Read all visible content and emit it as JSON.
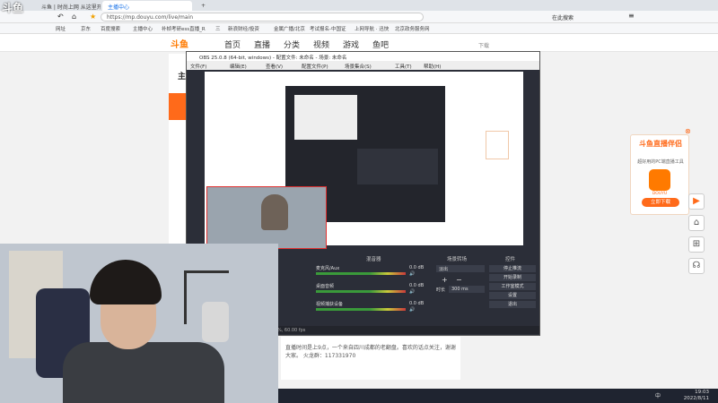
{
  "browser": {
    "tabs": [
      {
        "label": "斗鱼 | 时尚上网 从这里开始"
      },
      {
        "label": "主播中心",
        "active": true
      }
    ],
    "address": "https://mp.douyu.com/live/main",
    "search_label": "在此搜索",
    "bookmarks": [
      "网址",
      "京东",
      "百度搜索",
      "主播中心",
      "补帧考研ess直播_R",
      "三",
      "新浪财经/投资",
      "金属广播/北京",
      "考试报名-中国证",
      "上网导航 · 迅快",
      "北京政务服务网"
    ]
  },
  "site": {
    "logo": "斗鱼",
    "nav": [
      "首页",
      "直播",
      "分类",
      "视频",
      "游戏",
      "鱼吧"
    ],
    "left_heading": "主",
    "download": "下载",
    "announce": "直播时间是上9点，一个来自四川成都的老翻盘。喜欢的话点关注，谢谢大家。 火龙群：117331970"
  },
  "promo": {
    "title": "斗鱼直播伴侣",
    "subtitle": "超好用的PC端直播工具",
    "app_label": "DOUYU",
    "button": "立即下载"
  },
  "obs": {
    "title": "OBS 25.0.8 (64-bit, windows) - 配置文件: 未命名 - 场景: 未命名",
    "menu": [
      "文件(F)",
      "编辑(E)",
      "查看(V)",
      "配置文件(P)",
      "场景集合(S)",
      "工具(T)",
      "帮助(H)"
    ],
    "panels": {
      "mixer": "混音器",
      "transitions": "场景转场",
      "controls": "控件"
    },
    "channels": [
      {
        "name": "麦克风/Aux",
        "db": "0.0 dB"
      },
      {
        "name": "桌面音频",
        "db": "0.0 dB"
      },
      {
        "name": "视频捕获设备",
        "db": "0.0 dB"
      }
    ],
    "transition_value": "淡出",
    "duration_label": "时长",
    "duration_value": "300 ms",
    "controls": [
      "停止推流",
      "开始录制",
      "工作室模式",
      "设置",
      "退出"
    ],
    "status": "LIVE: 00:00:00   REC: 00:00:00   CPU: 2.9%, 60.00 fps"
  },
  "taskbar": {
    "lang": "中",
    "time": "19:03",
    "date": "2022/8/11"
  },
  "watermark": "斗鱼"
}
